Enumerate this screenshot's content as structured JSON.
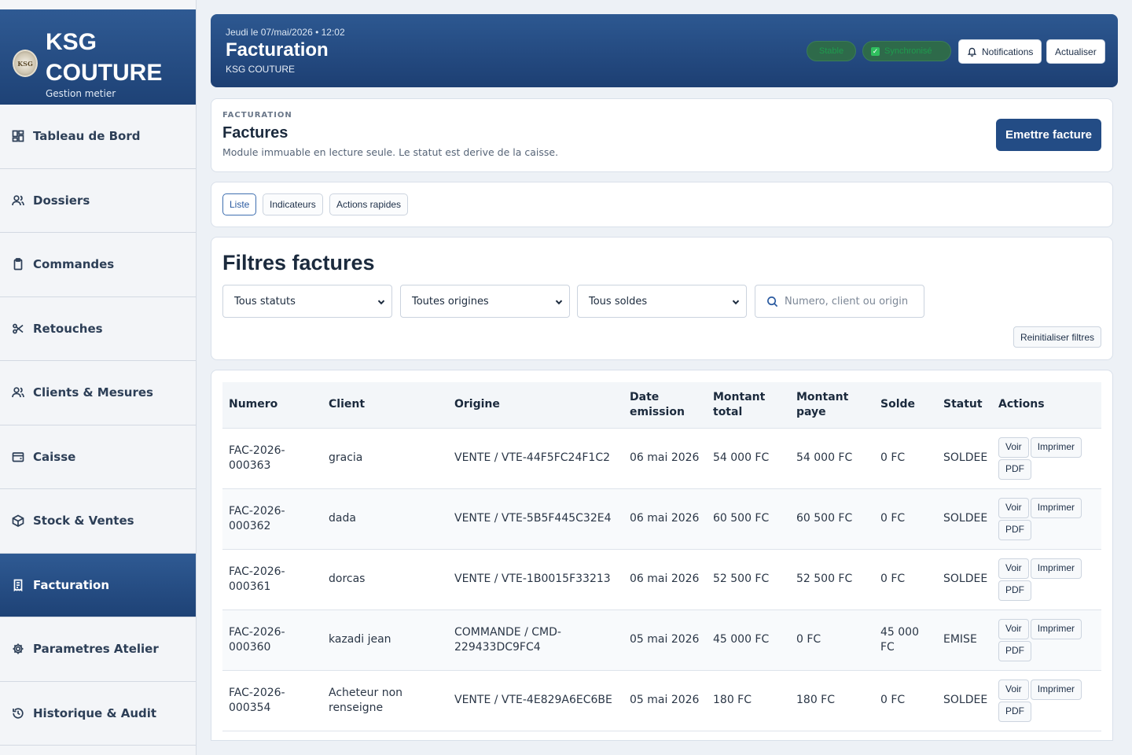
{
  "brand": {
    "logo_text": "KSG",
    "title": "KSG COUTURE",
    "subtitle": "Gestion metier"
  },
  "sidebar": {
    "items": [
      {
        "label": "Tableau de Bord",
        "icon": "dashboard-icon"
      },
      {
        "label": "Dossiers",
        "icon": "users-icon"
      },
      {
        "label": "Commandes",
        "icon": "clipboard-icon"
      },
      {
        "label": "Retouches",
        "icon": "scissors-icon"
      },
      {
        "label": "Clients & Mesures",
        "icon": "users-icon"
      },
      {
        "label": "Caisse",
        "icon": "wallet-icon"
      },
      {
        "label": "Stock & Ventes",
        "icon": "box-icon"
      },
      {
        "label": "Facturation",
        "icon": "receipt-icon",
        "active": true
      },
      {
        "label": "Parametres Atelier",
        "icon": "gear-icon"
      },
      {
        "label": "Historique & Audit",
        "icon": "history-icon"
      }
    ]
  },
  "header": {
    "date": "Jeudi le 07/mai/2026 • 12:02",
    "title": "Facturation",
    "subtitle": "KSG COUTURE",
    "pill_status": "Stable",
    "pill_sync": "Synchronisé",
    "notifications_label": "Notifications",
    "refresh_label": "Actualiser"
  },
  "intro": {
    "eyebrow": "FACTURATION",
    "title": "Factures",
    "description": "Module immuable en lecture seule. Le statut est derive de la caisse.",
    "issue_button": "Emettre facture"
  },
  "tabs": [
    {
      "label": "Liste",
      "active": true
    },
    {
      "label": "Indicateurs"
    },
    {
      "label": "Actions rapides"
    }
  ],
  "filters": {
    "title": "Filtres factures",
    "status_value": "Tous statuts",
    "origin_value": "Toutes origines",
    "balance_value": "Tous soldes",
    "search_placeholder": "Numero, client ou origin",
    "reset_label": "Reinitialiser filtres"
  },
  "table": {
    "columns": [
      "Numero",
      "Client",
      "Origine",
      "Date emission",
      "Montant total",
      "Montant paye",
      "Solde",
      "Statut",
      "Actions"
    ],
    "action_labels": {
      "view": "Voir",
      "print": "Imprimer",
      "pdf": "PDF"
    },
    "rows": [
      {
        "numero": "FAC-2026-000363",
        "client": "gracia",
        "origine": "VENTE / VTE-44F5FC24F1C2",
        "date": "06 mai 2026",
        "total": "54 000 FC",
        "paye": "54 000 FC",
        "solde": "0 FC",
        "statut": "SOLDEE"
      },
      {
        "numero": "FAC-2026-000362",
        "client": "dada",
        "origine": "VENTE / VTE-5B5F445C32E4",
        "date": "06 mai 2026",
        "total": "60 500 FC",
        "paye": "60 500 FC",
        "solde": "0 FC",
        "statut": "SOLDEE"
      },
      {
        "numero": "FAC-2026-000361",
        "client": "dorcas",
        "origine": "VENTE / VTE-1B0015F33213",
        "date": "06 mai 2026",
        "total": "52 500 FC",
        "paye": "52 500 FC",
        "solde": "0 FC",
        "statut": "SOLDEE"
      },
      {
        "numero": "FAC-2026-000360",
        "client": "kazadi jean",
        "origine": "COMMANDE / CMD-229433DC9FC4",
        "date": "05 mai 2026",
        "total": "45 000 FC",
        "paye": "0 FC",
        "solde": "45 000 FC",
        "statut": "EMISE"
      },
      {
        "numero": "FAC-2026-000354",
        "client": "Acheteur non renseigne",
        "origine": "VENTE / VTE-4E829A6EC6BE",
        "date": "05 mai 2026",
        "total": "180 FC",
        "paye": "180 FC",
        "solde": "0 FC",
        "statut": "SOLDEE"
      }
    ]
  },
  "colors": {
    "primary": "#234c85",
    "header_gradient_top": "#2d5891",
    "header_gradient_bottom": "#1d3f73",
    "success": "#2fbf5e"
  }
}
